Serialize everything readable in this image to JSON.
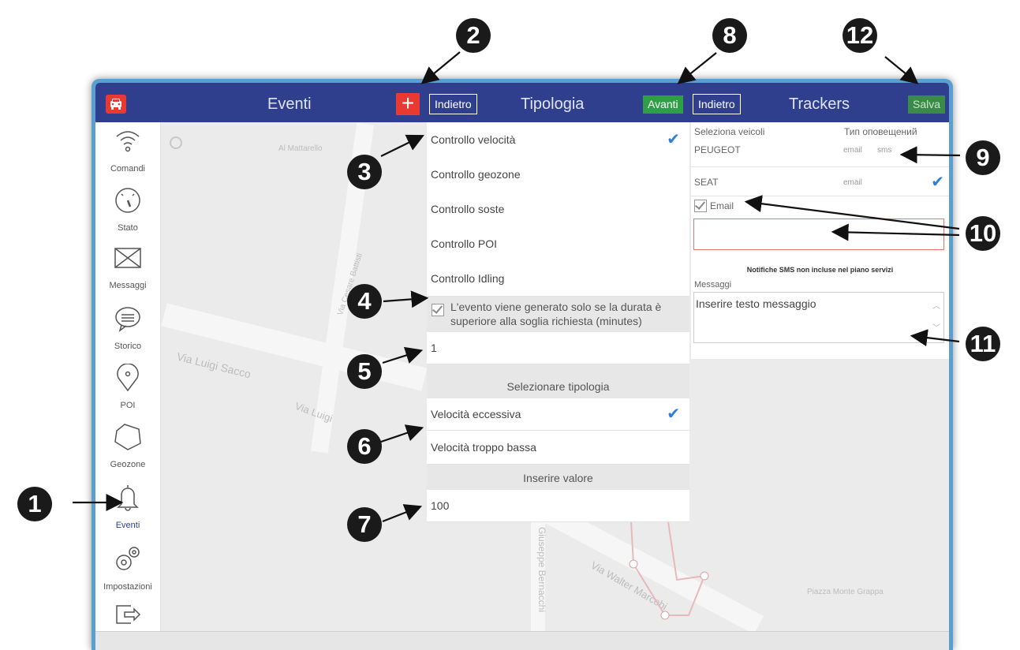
{
  "colors": {
    "header": "#2f3f8e",
    "accent_red": "#e83a33",
    "accent_green": "#2e9e47",
    "check_blue": "#2d7fd4",
    "frame": "#5a9fd0"
  },
  "topbar": {
    "eventi_title": "Eventi",
    "plus_label": "+",
    "indietro1": "Indietro",
    "tipologia_title": "Tipologia",
    "avanti": "Avanti",
    "indietro2": "Indietro",
    "trackers_title": "Trackers",
    "salva": "Salva"
  },
  "sidebar": {
    "items": [
      {
        "label": "Comandi",
        "icon": "wifi-icon"
      },
      {
        "label": "Stato",
        "icon": "gauge-icon"
      },
      {
        "label": "Messaggi",
        "icon": "envelope-icon"
      },
      {
        "label": "Storico",
        "icon": "chat-icon"
      },
      {
        "label": "POI",
        "icon": "pin-icon"
      },
      {
        "label": "Geozone",
        "icon": "polygon-icon"
      },
      {
        "label": "Eventi",
        "icon": "bell-icon"
      },
      {
        "label": "Impostazioni",
        "icon": "gears-icon"
      },
      {
        "label": "",
        "icon": "exit-icon"
      }
    ]
  },
  "tipologia": {
    "options": [
      "Controllo velocità",
      "Controllo geozone",
      "Controllo soste",
      "Controllo POI",
      "Controllo Idling"
    ],
    "duration_text": "L'evento viene generato solo se la durata è superiore alla soglia richiesta (minutes)",
    "duration_value": "1",
    "select_type_label": "Selezionare tipologia",
    "types": [
      "Velocità eccessiva",
      "Velocità troppo bassa"
    ],
    "insert_value_label": "Inserire valore",
    "value": "100"
  },
  "trackers": {
    "select_vehicles": "Seleziona veicoli",
    "notif_type": "Тип оповещений",
    "vehicles": [
      {
        "name": "PEUGEOT",
        "email": "email",
        "sms": "sms"
      },
      {
        "name": "SEAT",
        "email": "email",
        "sms": ""
      }
    ],
    "email_label": "Email",
    "sms_notice": "Notifiche SMS non incluse nel piano servizi",
    "messages_label": "Messaggi",
    "message_placeholder": "Inserire testo messaggio"
  },
  "badges": [
    "1",
    "2",
    "3",
    "4",
    "5",
    "6",
    "7",
    "8",
    "9",
    "10",
    "11",
    "12"
  ],
  "map_labels": [
    "Via Luigi Sacco",
    "Via Luigi",
    "Via Walter Marcobi",
    "Via Cesare Battisti",
    "Giuseppe Bernacchi",
    "Piazza Monte Grappa",
    "Al Mattarello"
  ]
}
